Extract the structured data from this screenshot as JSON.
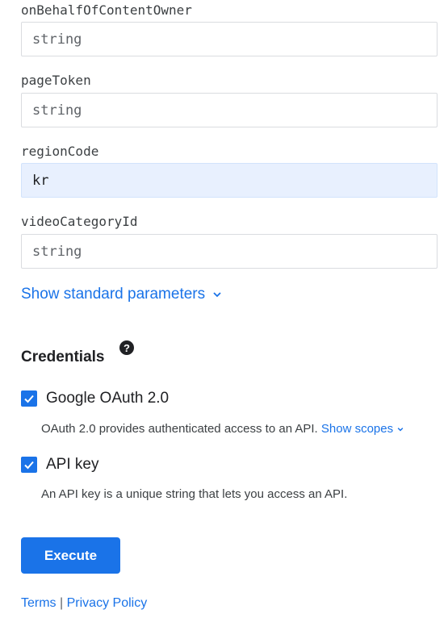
{
  "params": [
    {
      "label": "onBehalfOfContentOwner",
      "value": "",
      "placeholder": "string"
    },
    {
      "label": "pageToken",
      "value": "",
      "placeholder": "string"
    },
    {
      "label": "regionCode",
      "value": "kr",
      "placeholder": "string"
    },
    {
      "label": "videoCategoryId",
      "value": "",
      "placeholder": "string"
    }
  ],
  "show_standard_parameters": "Show standard parameters",
  "credentials": {
    "title": "Credentials",
    "help_icon": "?",
    "items": [
      {
        "name": "Google OAuth 2.0",
        "checked": true,
        "description": "OAuth 2.0 provides authenticated access to an API.",
        "link": "Show scopes"
      },
      {
        "name": "API key",
        "checked": true,
        "description": "An API key is a unique string that lets you access an API."
      }
    ]
  },
  "execute_label": "Execute",
  "footer": {
    "terms": "Terms",
    "separator": "|",
    "privacy": "Privacy Policy"
  },
  "colors": {
    "accent": "#1a73e8",
    "filled_input_bg": "#e8f0fe"
  },
  "icons": [
    "chevron-down-icon",
    "help-icon",
    "checkbox-checked-icon"
  ]
}
